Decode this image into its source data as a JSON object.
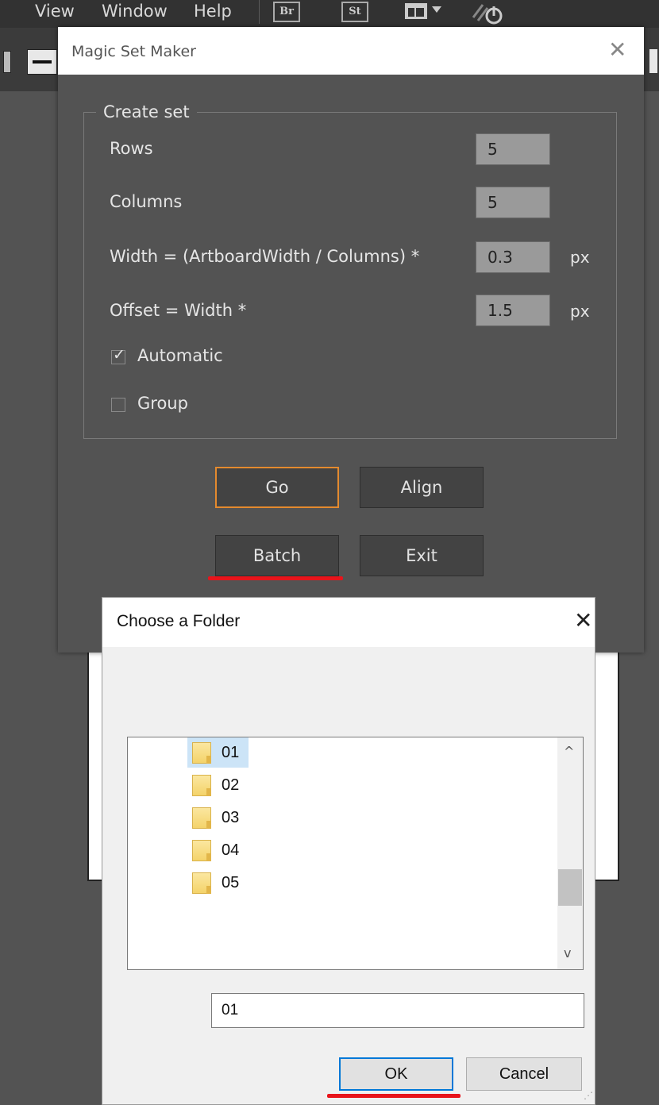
{
  "app_menu": {
    "items": [
      "View",
      "Window",
      "Help"
    ],
    "bridge_icon_label": "Br",
    "stock_icon_label": "St",
    "icons": [
      "workspace-switcher-icon",
      "sync-icon"
    ]
  },
  "magic_set_maker": {
    "title": "Magic Set Maker",
    "group_title": "Create set",
    "rows_label": "Rows",
    "rows_value": "5",
    "columns_label": "Columns",
    "columns_value": "5",
    "width_label": "Width = (ArtboardWidth / Columns) *",
    "width_value": "0.3",
    "width_unit": "px",
    "offset_label": "Offset = Width *",
    "offset_value": "1.5",
    "offset_unit": "px",
    "automatic_label": "Automatic",
    "automatic_checked": true,
    "group_label": "Group",
    "group_checked": false,
    "buttons": {
      "go": "Go",
      "align": "Align",
      "batch": "Batch",
      "exit": "Exit"
    }
  },
  "choose_folder": {
    "title": "Choose a Folder",
    "folders": [
      "01",
      "02",
      "03",
      "04",
      "05"
    ],
    "selected_folder": "01",
    "path_value": "01",
    "ok_label": "OK",
    "cancel_label": "Cancel"
  },
  "colors": {
    "panel_bg": "#535353",
    "focus_orange": "#e48a2e",
    "annotation_red": "#e8141b",
    "windows_blue": "#0078d7",
    "selection_blue": "#cce4f7"
  }
}
